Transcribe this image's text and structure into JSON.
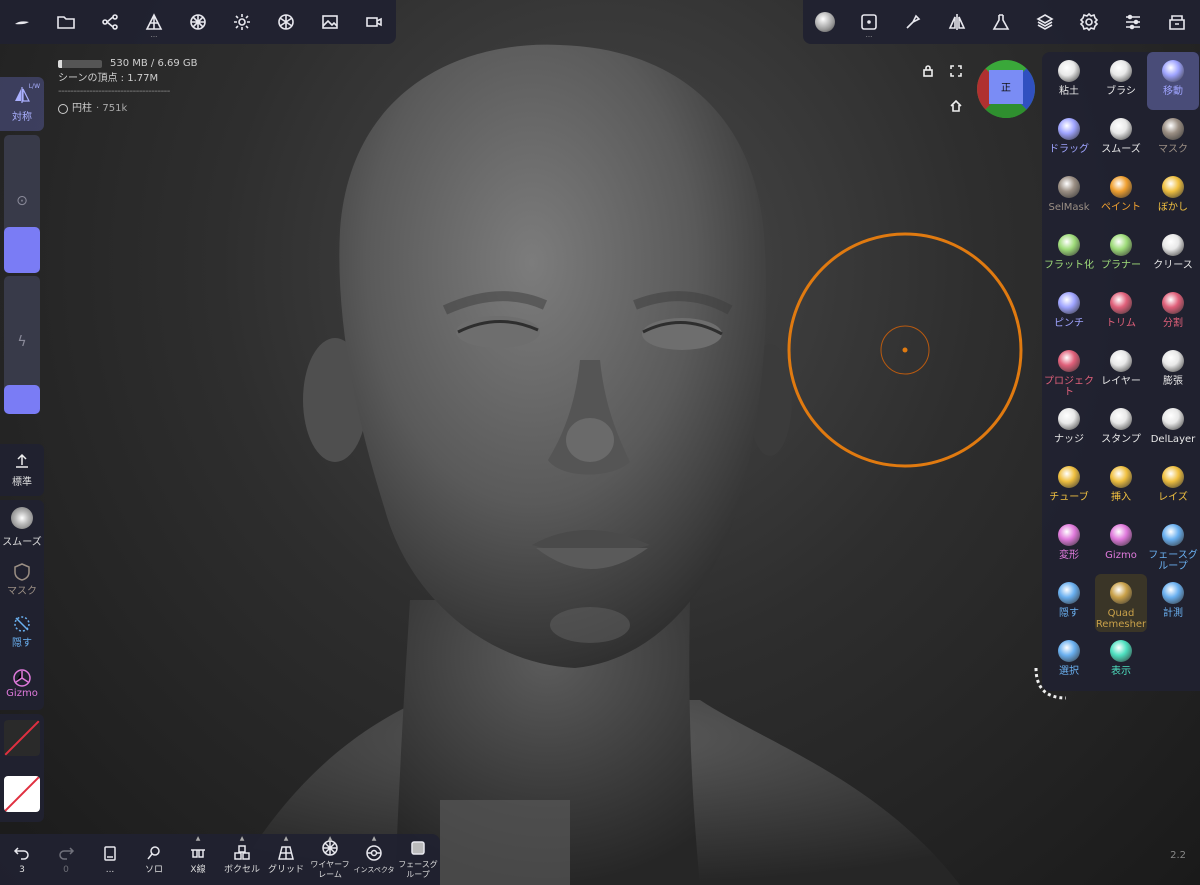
{
  "viewport": {
    "memory_text": "530 MB / 6.69 GB",
    "memory_used_fraction": 0.08,
    "scene_vertices": "シーンの頂点 : 1.77M",
    "separator": "------------------------------------",
    "object_label": "円柱",
    "object_count": " · 751k",
    "version": "2.2",
    "gizmo_face_label": "正"
  },
  "top_left_toolbar": {
    "items": [
      {
        "name": "nomad-logo-icon"
      },
      {
        "name": "folder-icon"
      },
      {
        "name": "scene-graph-icon"
      },
      {
        "name": "mesh-icon"
      },
      {
        "name": "topology-icon"
      },
      {
        "name": "light-icon"
      },
      {
        "name": "material-icon"
      },
      {
        "name": "image-icon"
      },
      {
        "name": "camera-icon"
      }
    ]
  },
  "top_right_toolbar": {
    "items": [
      {
        "name": "matcap-icon"
      },
      {
        "name": "stroke-icon"
      },
      {
        "name": "brush-settings-icon"
      },
      {
        "name": "symmetry-icon"
      },
      {
        "name": "flask-icon"
      },
      {
        "name": "layers-icon"
      },
      {
        "name": "gear-icon"
      },
      {
        "name": "sliders-icon"
      },
      {
        "name": "shop-icon"
      }
    ]
  },
  "left_panel": {
    "symmetry_label": "対称",
    "symmetry_flags": "L/W",
    "symmetry_sub": "x",
    "radius_fraction": 0.33,
    "intensity_fraction": 0.21,
    "standard_label": "標準",
    "smooth_label": "スムーズ",
    "mask_label": "マスク",
    "hide_label": "隠す",
    "gizmo_label": "Gizmo"
  },
  "tools": [
    {
      "label": "粘土",
      "color": "#e8e8e8"
    },
    {
      "label": "ブラシ",
      "color": "#e8e8e8"
    },
    {
      "label": "移動",
      "color": "#9fa4ff",
      "active": true
    },
    {
      "label": "ドラッグ",
      "color": "#9fa4ff"
    },
    {
      "label": "スムーズ",
      "color": "#e8e8e8"
    },
    {
      "label": "マスク",
      "color": "#9b8f84"
    },
    {
      "label": "SelMask",
      "color": "#9b8f84"
    },
    {
      "label": "ペイント",
      "color": "#f0a030"
    },
    {
      "label": "ぼかし",
      "color": "#f0c040"
    },
    {
      "label": "フラット化",
      "color": "#9fdc7a"
    },
    {
      "label": "プラナー",
      "color": "#9fdc7a"
    },
    {
      "label": "クリース",
      "color": "#e8e8e8"
    },
    {
      "label": "ピンチ",
      "color": "#9fa4ff"
    },
    {
      "label": "トリム",
      "color": "#e0607a"
    },
    {
      "label": "分割",
      "color": "#e0607a"
    },
    {
      "label": "プロジェクト",
      "color": "#e0607a"
    },
    {
      "label": "レイヤー",
      "color": "#e8e8e8"
    },
    {
      "label": "膨張",
      "color": "#e8e8e8"
    },
    {
      "label": "ナッジ",
      "color": "#e8e8e8"
    },
    {
      "label": "スタンプ",
      "color": "#e8e8e8"
    },
    {
      "label": "DelLayer",
      "color": "#e8e8e8"
    },
    {
      "label": "チューブ",
      "color": "#f0c040"
    },
    {
      "label": "挿入",
      "color": "#f0c040"
    },
    {
      "label": "レイズ",
      "color": "#f0c040"
    },
    {
      "label": "変形",
      "color": "#e07adc"
    },
    {
      "label": "Gizmo",
      "color": "#e07adc"
    },
    {
      "label": "フェースグループ",
      "color": "#6ab0f0"
    },
    {
      "label": "隠す",
      "color": "#6ab0f0"
    },
    {
      "label": "Quad Remesher",
      "color": "#c9a14a",
      "premium": true
    },
    {
      "label": "計測",
      "color": "#6ab0f0"
    },
    {
      "label": "選択",
      "color": "#6ab0f0"
    },
    {
      "label": "表示",
      "color": "#4ee0c0"
    }
  ],
  "bottom_bar": [
    {
      "name": "undo-icon",
      "label": "3"
    },
    {
      "name": "redo-icon",
      "label": "0"
    },
    {
      "name": "history-icon",
      "label": "..."
    },
    {
      "name": "solo-icon",
      "label": "ソロ"
    },
    {
      "name": "xray-icon",
      "label": "X線"
    },
    {
      "name": "voxel-icon",
      "label": "ボクセル"
    },
    {
      "name": "grid-icon",
      "label": "グリッド"
    },
    {
      "name": "wireframe-icon",
      "label": "ワイヤーフレーム"
    },
    {
      "name": "inspector-icon",
      "label": "インスペクタ"
    },
    {
      "name": "facegroup-icon",
      "label": "フェースグループ"
    }
  ]
}
